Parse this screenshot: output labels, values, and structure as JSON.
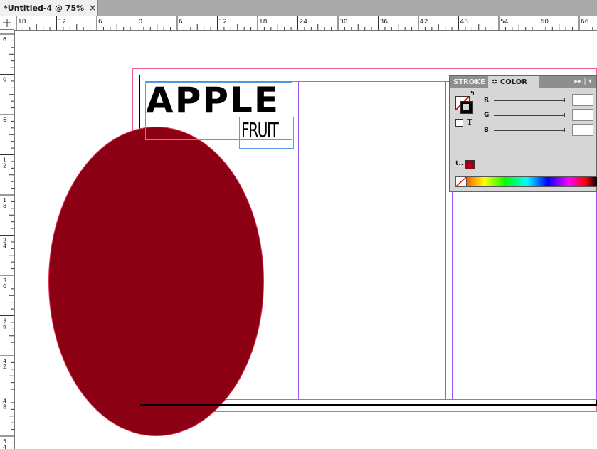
{
  "document_tab": {
    "title": "*Untitled-4 @ 75%",
    "close_glyph": "×"
  },
  "ruler": {
    "horizontal_labels": [
      "18",
      "12",
      "6",
      "0",
      "6",
      "12",
      "18",
      "24",
      "30",
      "36",
      "42",
      "48",
      "54",
      "60",
      "66"
    ],
    "vertical_labels": [
      "6",
      "0",
      "6",
      "12",
      "18",
      "24",
      "30",
      "36",
      "42",
      "48",
      "54"
    ]
  },
  "artwork": {
    "headline": "APPLE",
    "subhead": "FRUIT",
    "ellipse_color": "#8c0014"
  },
  "color_panel": {
    "tabs": [
      {
        "label": "STROKE"
      },
      {
        "label": "≎ COLOR"
      }
    ],
    "menu_glyph": "▸▸ | ▾",
    "channels": [
      {
        "label": "R"
      },
      {
        "label": "G"
      },
      {
        "label": "B"
      }
    ],
    "formatting_glyph": "T",
    "tint_glyph": "t.."
  },
  "colors": {
    "bleed_guide": "#ef5c8a",
    "margin_guide": "#b05ee0",
    "frame_select": "#5a9ae6",
    "fill_swatch": "#a00012"
  }
}
